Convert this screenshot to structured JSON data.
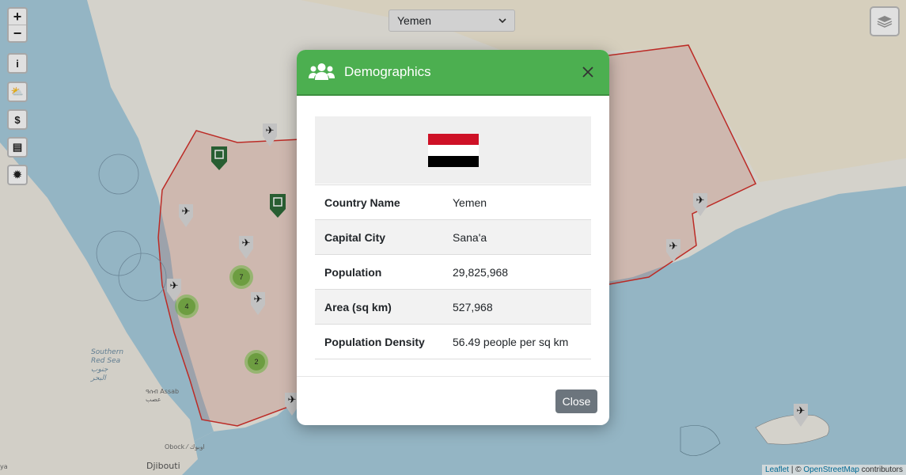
{
  "country_select": {
    "value": "Yemen"
  },
  "map_labels": {
    "africa": "Djibouti",
    "obock": "Obock ⁄ اوبوك",
    "assab": "ዓሰብ Assab\nعصب",
    "red_sea": "Southern\nRed Sea\nجنوب\nالبحر",
    "ya": "ya"
  },
  "controls": {
    "zoom_in": "+",
    "zoom_out": "−",
    "info": "i",
    "weather": "⛅",
    "currency": "$",
    "news": "▤",
    "virus": "✹"
  },
  "clusters": [
    "7",
    "4",
    "2"
  ],
  "attribution": {
    "leaflet": "Leaflet",
    "sep": "| ©",
    "osm": "OpenStreetMap",
    "contributors": "contributors"
  },
  "modal": {
    "title": "Demographics",
    "rows": [
      {
        "label": "Country Name",
        "value": "Yemen"
      },
      {
        "label": "Capital City",
        "value": "Sana'a"
      },
      {
        "label": "Population",
        "value": "29,825,968"
      },
      {
        "label": "Area (sq km)",
        "value": "527,968"
      },
      {
        "label": "Population Density",
        "value": "56.49 people per sq km"
      }
    ],
    "close_label": "Close"
  },
  "colors": {
    "header": "#4caf50",
    "close_button": "#6c757d",
    "border": "#d6322c",
    "flag_red": "#ce1126",
    "flag_black": "#000000"
  }
}
